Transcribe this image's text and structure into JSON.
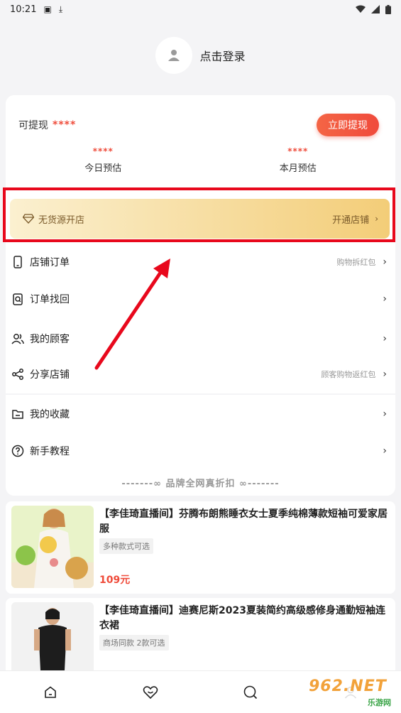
{
  "status": {
    "time": "10:21"
  },
  "login": {
    "label": "点击登录"
  },
  "earnings": {
    "withdraw_label": "可提现",
    "withdraw_value": "****",
    "withdraw_button": "立即提现",
    "today_value": "****",
    "today_label": "今日预估",
    "month_value": "****",
    "month_label": "本月预估"
  },
  "shop_banner": {
    "label": "无货源开店",
    "action": "开通店铺"
  },
  "menu": [
    {
      "label": "店铺订单",
      "hint": "购物拆红包",
      "icon": "phone-icon"
    },
    {
      "label": "订单找回",
      "hint": "",
      "icon": "search-clipboard-icon"
    },
    {
      "label": "我的顾客",
      "hint": "",
      "icon": "users-icon"
    },
    {
      "label": "分享店铺",
      "hint": "顾客购物返红包",
      "icon": "share-icon"
    },
    {
      "label": "我的收藏",
      "hint": "",
      "icon": "folder-icon"
    },
    {
      "label": "新手教程",
      "hint": "",
      "icon": "help-icon"
    }
  ],
  "section_title": "-------∞  品牌全网真折扣  ∞-------",
  "products": [
    {
      "title": "【李佳琦直播间】芬腾布朗熊睡衣女士夏季纯棉薄款短袖可爱家居服",
      "tag": "多种款式可选",
      "price": "109元"
    },
    {
      "title": "【李佳琦直播间】迪赛尼斯2023夏装简约高级感修身通勤短袖连衣裙",
      "tag": "商场同款 2款可选",
      "price": ""
    }
  ],
  "tabbar": [
    "home-icon",
    "heart-icon",
    "search-icon",
    "user-icon"
  ],
  "watermark": {
    "top": "962.NET",
    "bottom": "乐游网"
  },
  "colors": {
    "accent": "#ef4b3a",
    "highlight": "#e8081c",
    "banner_gold": "#f3cd78"
  }
}
